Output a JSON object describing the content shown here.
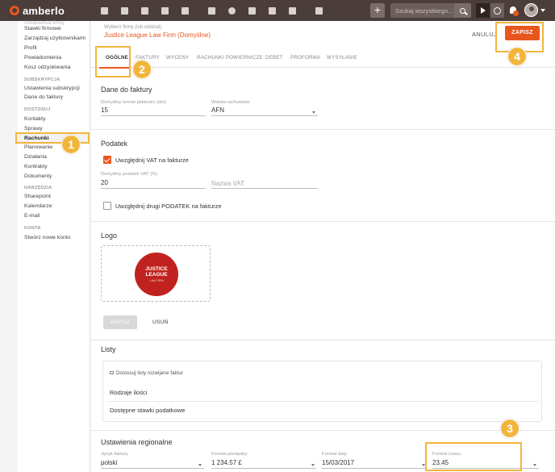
{
  "app": {
    "name": "amberlo"
  },
  "topbar": {
    "search_placeholder": "Szukaj wszystkiego...",
    "icons": [
      "dashboard-icon",
      "contacts-icon",
      "matters-icon",
      "documents-icon",
      "bank-icon",
      "calendar-icon",
      "history-icon",
      "folder-icon",
      "file-icon",
      "mail-icon",
      "reports-icon"
    ]
  },
  "sidebar": {
    "items_top": [
      "Stawki firmowe",
      "Zarządzaj użytkownikami",
      "Profil",
      "Powiadomienia",
      "Kosz odzyskiwania"
    ],
    "subscription_head": "SUBSKRYPCJA",
    "subscription_items": [
      "Ustawienia subskrypcji",
      "Dane do faktury"
    ],
    "customize_head": "DOSTOSUJ",
    "customize_items": [
      "Kontakty",
      "Sprawy",
      "Rachunki",
      "Planowanie",
      "Działania",
      "Kontrakty",
      "Dokumenty"
    ],
    "tools_head": "NARZĘDZIA",
    "tools_items": [
      "Sharepoint",
      "Kalendarze",
      "E-mail"
    ],
    "account_head": "KONTA",
    "account_items": [
      "Stwórz nowe konto"
    ]
  },
  "header": {
    "firm_label": "Wybierz firmę (lub oddział)",
    "firm_value": "Justice League Law Firm (Domyślne)",
    "cancel_label": "ANULUJ",
    "save_label": "ZAPISZ"
  },
  "tabs": [
    "OGÓLNE",
    "FAKTURY",
    "WYCENY",
    "RACHUNKI POWIERNICZE",
    "DEBET",
    "PROFORMA",
    "WYSYŁANIE"
  ],
  "invoice_data": {
    "title": "Dane do faktury",
    "payment_term_label": "Domyślny termin płatności (dni)",
    "payment_term_value": "15",
    "currency_label": "Waluta rachunków",
    "currency_value": "AFN"
  },
  "tax": {
    "title": "Podatek",
    "include_vat_label": "Uwzględnij VAT na fakturze",
    "include_vat_checked": true,
    "vat_rate_label": "Domyślny podatek VAT (%)",
    "vat_rate_value": "20",
    "vat_name_placeholder": "Nazwa VAT",
    "second_tax_label": "Uwzględnij drugi PODATEK na fakturze",
    "second_tax_checked": false
  },
  "logo": {
    "title": "Logo",
    "image_text_line1": "JUSTICE",
    "image_text_line2": "LEAGUE",
    "image_text_sub": "LAW FIRM",
    "save_label": "ZAPISZ",
    "remove_label": "USUŃ"
  },
  "lists": {
    "title": "Listy",
    "customize_label": "Dostosuj listy rozwijane faktur",
    "rows": [
      "Rodzaje ilości",
      "Dostępne stawki podatkowe"
    ]
  },
  "regional": {
    "title": "Ustawienia regionalne",
    "language_label": "Język faktury",
    "language_value": "polski",
    "money_format_label": "Format pieniędzy",
    "money_format_value": "1 234.57 £",
    "date_format_label": "Format daty",
    "date_format_value": "15/03/2017",
    "time_format_label": "Format czasu",
    "time_format_value": "23.45"
  },
  "annotations": [
    "1",
    "2",
    "3",
    "4"
  ],
  "colors": {
    "accent": "#e8561e",
    "topbar": "#4a3d3a",
    "marker": "#f2b53c"
  }
}
